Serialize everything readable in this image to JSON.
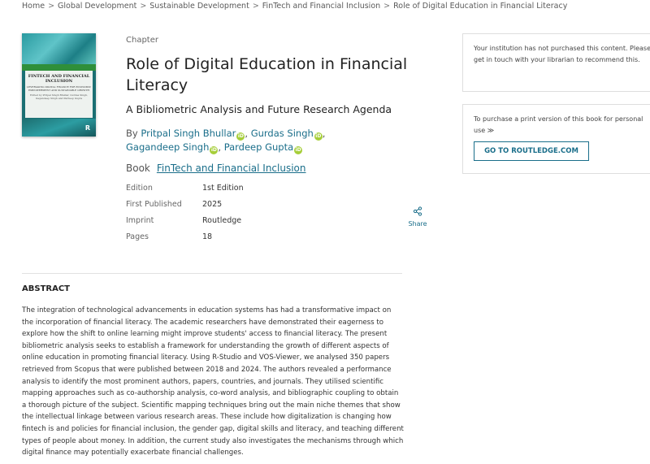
{
  "breadcrumb": [
    "Home",
    "Global Development",
    "Sustainable Development",
    "FinTech and Financial Inclusion",
    "Role of Digital Education in Financial Literacy"
  ],
  "cover": {
    "title_line1": "FINTECH AND FINANCIAL",
    "title_line2": "INCLUSION",
    "subtitle": "LEVERAGING DIGITAL FINANCE FOR ECONOMIC EMPOWERMENT AND SUSTAINABLE GROWTH",
    "editors": "Edited by Pritpal Singh Bhullar, Gurdas Singh, Gagandeep Singh and Pardeep Gupta",
    "logo": "R"
  },
  "chapter_label": "Chapter",
  "title": "Role of Digital Education in Financial Literacy",
  "subtitle": "A Bibliometric Analysis and Future Research Agenda",
  "authors": {
    "prefix": "By",
    "list": [
      "Pritpal Singh Bhullar",
      "Gurdas Singh",
      "Gagandeep Singh",
      "Pardeep Gupta"
    ]
  },
  "book": {
    "label": "Book",
    "title": "FinTech and Financial Inclusion"
  },
  "meta": [
    {
      "key": "Edition",
      "value": "1st Edition"
    },
    {
      "key": "First Published",
      "value": "2025"
    },
    {
      "key": "Imprint",
      "value": "Routledge"
    },
    {
      "key": "Pages",
      "value": "18"
    }
  ],
  "share": {
    "label": "Share",
    "icon": "share-icon"
  },
  "abstract": {
    "heading": "ABSTRACT",
    "text": "The integration of technological advancements in education systems has had a transformative impact on the incorporation of financial literacy. The academic researchers have demonstrated their eagerness to explore how the shift to online learning might improve students' access to financial literacy. The present bibliometric analysis seeks to establish a framework for understanding the growth of different aspects of online education in promoting financial literacy. Using R-Studio and VOS-Viewer, we analysed 350 papers retrieved from Scopus that were published between 2018 and 2024. The authors revealed a performance analysis to identify the most prominent authors, papers, countries, and journals. They utilised scientific mapping approaches such as co-authorship analysis, co-word analysis, and bibliographic coupling to obtain a thorough picture of the subject. Scientific mapping techniques bring out the main niche themes that show the intellectual linkage between various research areas. These include how digitalization is changing how fintech is and policies for financial inclusion, the gender gap, digital skills and literacy, and teaching different types of people about money. In addition, the current study also investigates the mechanisms through which digital finance may potentially exacerbate financial challenges."
  },
  "sidebar": {
    "access_notice": "Your institution has not purchased this content. Please get in touch with your librarian to recommend this.",
    "purchase_text": "To purchase a print version of this book for personal use",
    "purchase_arrow": "≫",
    "routledge_button": "GO TO ROUTLEDGE.COM"
  },
  "colors": {
    "link": "#1a6e8a",
    "orcid": "#a6ce39"
  }
}
